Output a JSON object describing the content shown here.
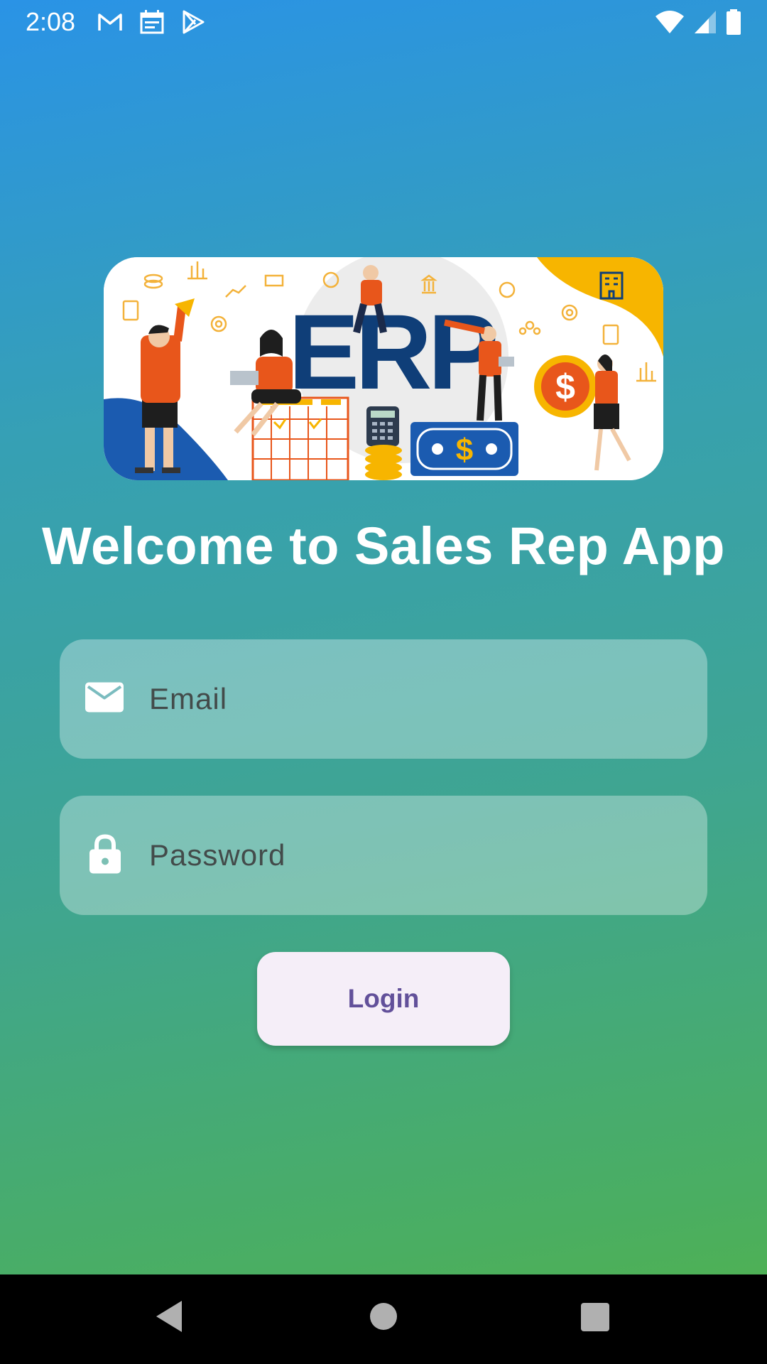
{
  "status_bar": {
    "time": "2:08",
    "notification_icons": [
      "gmail-icon",
      "calendar-icon",
      "play-store-icon"
    ],
    "system_icons": [
      "wifi-icon",
      "signal-icon",
      "battery-icon"
    ]
  },
  "banner": {
    "logo_text": "ERP",
    "icon": "erp-illustration"
  },
  "title": "Welcome to Sales Rep App",
  "email": {
    "placeholder": "Email",
    "value": "",
    "icon": "mail-icon"
  },
  "password": {
    "placeholder": "Password",
    "value": "",
    "icon": "lock-icon"
  },
  "login_label": "Login",
  "nav": {
    "back": "back-icon",
    "home": "home-icon",
    "recents": "recents-icon"
  },
  "colors": {
    "gradient_top": "#2a93e6",
    "gradient_bottom": "#52b24a",
    "button_bg": "#f5eef8",
    "button_text": "#62509a",
    "banner_yellow": "#f7b500",
    "banner_blue": "#1b5bb0",
    "banner_orange": "#e8561b"
  }
}
